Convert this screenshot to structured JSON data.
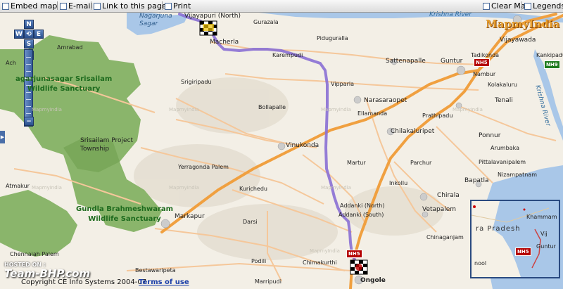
{
  "toolbar": {
    "embed": "Embed map",
    "email": "E-mail",
    "link": "Link to this page",
    "print": "Print",
    "clear": "Clear Map",
    "legends": "Legends"
  },
  "nav": {
    "n": "N",
    "w": "W",
    "e": "E",
    "s": "S",
    "center": "⟲",
    "zoom_in": "+",
    "zoom_out": "−"
  },
  "logo": "MapmyIndia",
  "water": {
    "nagarjuna_sagar": "Nagarjuna\nSagar",
    "krishna_river": "Krishna River",
    "krishna_river_vertical": "Krishna River"
  },
  "places": {
    "vijayapuri": "Vijayapuri (North)",
    "macherla": "Macherla",
    "gurazala": "Gurazala",
    "piduguralla": "Piduguralla",
    "karempudi": "Karempudi",
    "sattenapalle": "Sattenapalle",
    "guntur": "Guntur",
    "vijayawada": "Vijayawada",
    "tadikonda": "Tadikonda",
    "kankipadu": "Kankipadu",
    "nambur": "Nambur",
    "kolakaluru": "Kolakaluru",
    "tenali": "Tenali",
    "vipparla": "Vipparla",
    "narasaraopet": "Narasaraopet",
    "ellamanda": "Ellamanda",
    "prathipadu": "Prathipadu",
    "chilakaluripet": "Chilakaluripet",
    "ponnur": "Ponnur",
    "arumbaka": "Arumbaka",
    "pittalavanipalem": "Pittalavanipalem",
    "nizampatnam": "Nizampatnam",
    "bapatla": "Bapatla",
    "chirala": "Chirala",
    "vetapalem": "Vetapalem",
    "inkollu": "Inkollu",
    "parchur": "Parchur",
    "martur": "Martur",
    "addanki_n": "Addanki (North)",
    "addanki_s": "Addanki (South)",
    "chinaganjam": "Chinaganjam",
    "ongole": "Ongole",
    "marripudi": "Marripudi",
    "chimakurthi": "Chimakurthi",
    "podili": "Podili",
    "darsi": "Darsi",
    "markapur": "Markapur",
    "kurichedu": "Kurichedu",
    "vinukonda": "Vinukonda",
    "yerragonda_palem": "Yerragonda Palem",
    "bollapalle": "Bollapalle",
    "srigiripadu": "Srigiripadu",
    "amrabad": "Amrabad",
    "achampet": "Ach",
    "srisailam_township": "Srisailam Project\nTownship",
    "atmakur": "Atmakur",
    "chennaiah_palem": "Chennaiah Palem",
    "bestawaripeta": "Bestawaripeta",
    "srisailam_sanctuary": "agarjunasagar Srisailam\nWildlife Sanctuary",
    "gundla_sanctuary": "Gundla Brahmeshwaram\nWildlife Sanctuary"
  },
  "watermark": "MapmyIndia",
  "highways": {
    "nh5_a": "NH5",
    "nh5_b": "NH5",
    "nh9": "NH9"
  },
  "inset": {
    "state": "ra Pradesh",
    "khammam": "Khammam",
    "vijay": "Vij",
    "guntur": "Guntur",
    "nool": "nool",
    "nh5": "NH5"
  },
  "footer": {
    "copyright": "Copyright CE Info Systems 2004-07",
    "terms": "Terms of use"
  },
  "branding": {
    "hosted": "HOSTED ON :",
    "site": "Team-BHP.com"
  },
  "colors": {
    "route": "#8a6fd4",
    "forest": "#8ab56b",
    "highway": "#f0a040",
    "road": "#f5c79a",
    "water": "#a9c7e8"
  }
}
